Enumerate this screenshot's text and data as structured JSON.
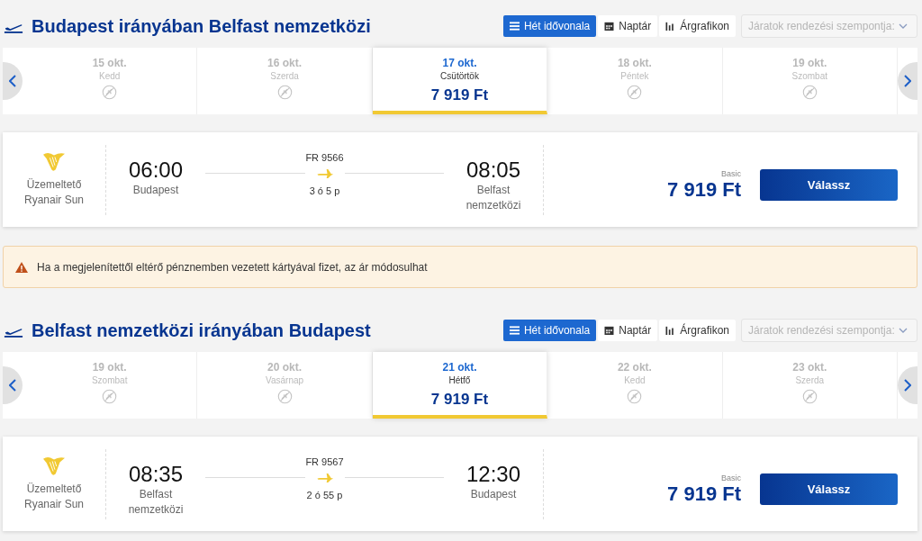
{
  "blocks": [
    {
      "kind": "route",
      "title": "Budapest irányában Belfast nemzetközi",
      "views": [
        {
          "kind": "list",
          "label": "Hét idővonala",
          "selected": true
        },
        {
          "kind": "calendar",
          "label": "Naptár",
          "selected": false
        },
        {
          "kind": "chart",
          "label": "Árgrafikon",
          "selected": false
        }
      ],
      "sort_placeholder": "Járatok rendezési szempontja:",
      "days": [
        {
          "date": "15 okt.",
          "weekday": "Kedd",
          "selected": false
        },
        {
          "date": "16 okt.",
          "weekday": "Szerda",
          "selected": false
        },
        {
          "date": "17 okt.",
          "weekday": "Csütörtök",
          "price": "7 919 Ft",
          "selected": true
        },
        {
          "date": "18 okt.",
          "weekday": "Péntek",
          "selected": false
        },
        {
          "date": "19 okt.",
          "weekday": "Szombat",
          "selected": false
        }
      ],
      "flight": {
        "operator_label": "Üzemeltető",
        "operator": "Ryanair Sun",
        "depart_time": "06:00",
        "depart_city": "Budapest",
        "flight_no": "FR 9566",
        "duration": "3 ó 5 p",
        "arrive_time": "08:05",
        "arrive_city": "Belfast nemzetközi",
        "fare": "Basic",
        "price": "7 919 Ft",
        "button": "Válassz"
      }
    },
    {
      "kind": "warning",
      "text": "Ha a megjelenítettől eltérő pénznemben vezetett kártyával fizet, az ár módosulhat"
    },
    {
      "kind": "route",
      "title": "Belfast nemzetközi irányában Budapest",
      "views": [
        {
          "kind": "list",
          "label": "Hét idővonala",
          "selected": true
        },
        {
          "kind": "calendar",
          "label": "Naptár",
          "selected": false
        },
        {
          "kind": "chart",
          "label": "Árgrafikon",
          "selected": false
        }
      ],
      "sort_placeholder": "Járatok rendezési szempontja:",
      "days": [
        {
          "date": "19 okt.",
          "weekday": "Szombat",
          "selected": false
        },
        {
          "date": "20 okt.",
          "weekday": "Vasárnap",
          "selected": false
        },
        {
          "date": "21 okt.",
          "weekday": "Hétfő",
          "price": "7 919 Ft",
          "selected": true
        },
        {
          "date": "22 okt.",
          "weekday": "Kedd",
          "selected": false
        },
        {
          "date": "23 okt.",
          "weekday": "Szerda",
          "selected": false
        }
      ],
      "flight": {
        "operator_label": "Üzemeltető",
        "operator": "Ryanair Sun",
        "depart_time": "08:35",
        "depart_city": "Belfast nemzetközi",
        "flight_no": "FR 9567",
        "duration": "2 ó 55 p",
        "arrive_time": "12:30",
        "arrive_city": "Budapest",
        "fare": "Basic",
        "price": "7 919 Ft",
        "button": "Válassz"
      }
    }
  ]
}
